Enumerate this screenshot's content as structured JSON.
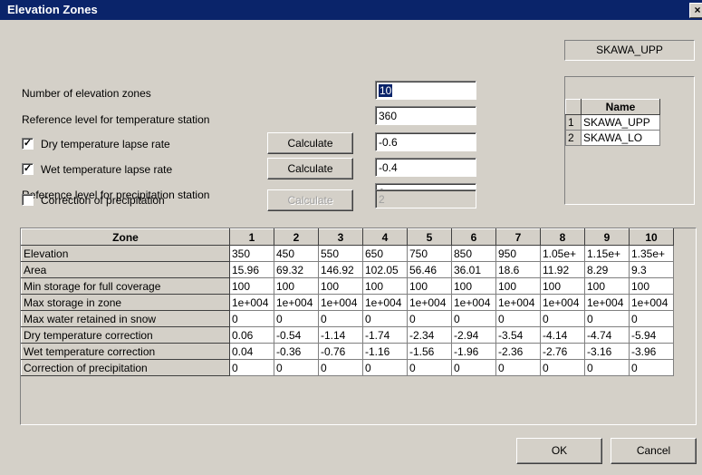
{
  "window": {
    "title": "Elevation Zones",
    "close_label": "×"
  },
  "form": {
    "num_zones_label": "Number of elevation zones",
    "num_zones_value": "10",
    "ref_temp_label": "Reference level for temperature station",
    "ref_temp_value": "360",
    "dry_lapse_label": "Dry temperature lapse rate",
    "dry_lapse_checked": "✓",
    "dry_lapse_value": "-0.6",
    "wet_lapse_label": "Wet temperature lapse rate",
    "wet_lapse_checked": "✓",
    "wet_lapse_value": "-0.4",
    "ref_precip_label": "Reference level for precipitation station",
    "ref_precip_value": "0",
    "corr_precip_label": "Correction of precipitation",
    "corr_precip_checked": "",
    "corr_precip_value": "2",
    "calculate_label": "Calculate"
  },
  "station": {
    "current": "SKAWA_UPP",
    "name_header": "Name",
    "rows": [
      {
        "index": "1",
        "name": "SKAWA_UPP"
      },
      {
        "index": "2",
        "name": "SKAWA_LO"
      }
    ]
  },
  "grid": {
    "corner": "Zone",
    "columns": [
      "1",
      "2",
      "3",
      "4",
      "5",
      "6",
      "7",
      "8",
      "9",
      "10"
    ],
    "rows": [
      {
        "label": "Elevation",
        "values": [
          "350",
          "450",
          "550",
          "650",
          "750",
          "850",
          "950",
          "1.05e+",
          "1.15e+",
          "1.35e+"
        ]
      },
      {
        "label": "Area",
        "values": [
          "15.96",
          "69.32",
          "146.92",
          "102.05",
          "56.46",
          "36.01",
          "18.6",
          "11.92",
          "8.29",
          "9.3"
        ]
      },
      {
        "label": "Min storage for full coverage",
        "values": [
          "100",
          "100",
          "100",
          "100",
          "100",
          "100",
          "100",
          "100",
          "100",
          "100"
        ]
      },
      {
        "label": "Max storage in zone",
        "values": [
          "1e+004",
          "1e+004",
          "1e+004",
          "1e+004",
          "1e+004",
          "1e+004",
          "1e+004",
          "1e+004",
          "1e+004",
          "1e+004"
        ]
      },
      {
        "label": "Max water retained in snow",
        "values": [
          "0",
          "0",
          "0",
          "0",
          "0",
          "0",
          "0",
          "0",
          "0",
          "0"
        ]
      },
      {
        "label": "Dry temperature correction",
        "values": [
          "0.06",
          "-0.54",
          "-1.14",
          "-1.74",
          "-2.34",
          "-2.94",
          "-3.54",
          "-4.14",
          "-4.74",
          "-5.94"
        ]
      },
      {
        "label": "Wet temperature correction",
        "values": [
          "0.04",
          "-0.36",
          "-0.76",
          "-1.16",
          "-1.56",
          "-1.96",
          "-2.36",
          "-2.76",
          "-3.16",
          "-3.96"
        ]
      },
      {
        "label": "Correction of precipitation",
        "values": [
          "0",
          "0",
          "0",
          "0",
          "0",
          "0",
          "0",
          "0",
          "0",
          "0"
        ]
      }
    ]
  },
  "buttons": {
    "ok_label": "OK",
    "cancel_label": "Cancel"
  }
}
